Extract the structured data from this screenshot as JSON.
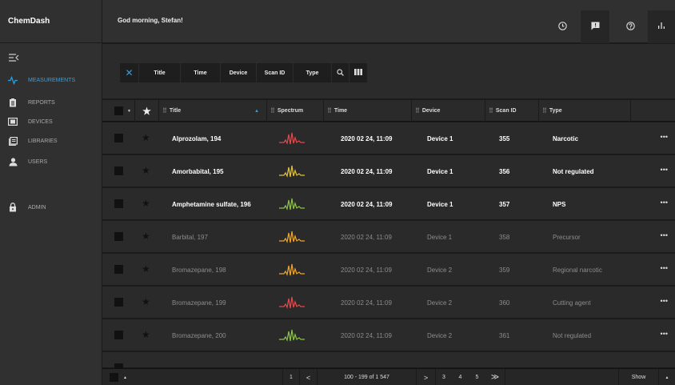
{
  "app": {
    "title": "ChemDash"
  },
  "header": {
    "greeting": "God morning, Stefan!",
    "icons": [
      "clock-icon",
      "chat-icon",
      "help-icon",
      "chart-icon"
    ]
  },
  "sidebar": {
    "items": [
      {
        "label": "MEASUREMENTS",
        "icon": "measurements-icon",
        "active": true
      },
      {
        "label": "REPORTS",
        "icon": "reports-icon"
      },
      {
        "label": "DEVICES",
        "icon": "devices-icon"
      },
      {
        "label": "LIBRARIES",
        "icon": "libraries-icon"
      },
      {
        "label": "USERS",
        "icon": "users-icon"
      },
      {
        "label": "ADMIN",
        "icon": "lock-icon"
      }
    ]
  },
  "filters": {
    "chips": [
      "Title",
      "Time",
      "Device",
      "Scan ID",
      "Type"
    ]
  },
  "table": {
    "columns": [
      "Title",
      "Spectrum",
      "Time",
      "Device",
      "Scan ID",
      "Type"
    ],
    "rows": [
      {
        "title": "Alprozolam, 194",
        "time": "2020 02 24, 11:09",
        "device": "Device 1",
        "scan_id": "355",
        "type": "Narcotic",
        "spectrum_color": "#e8474b",
        "bold": true
      },
      {
        "title": "Amorbabital, 195",
        "time": "2020 02 24, 11:09",
        "device": "Device 1",
        "scan_id": "356",
        "type": "Not regulated",
        "spectrum_color": "#e3c13b",
        "bold": true
      },
      {
        "title": "Amphetamine sulfate, 196",
        "time": "2020 02 24, 11:09",
        "device": "Device 1",
        "scan_id": "357",
        "type": "NPS",
        "spectrum_color": "#8bc34a",
        "bold": true
      },
      {
        "title": "Barbital, 197",
        "time": "2020 02 24, 11:09",
        "device": "Device 1",
        "scan_id": "358",
        "type": "Precursor",
        "spectrum_color": "#f0a52c",
        "bold": false
      },
      {
        "title": "Bromazepane, 198",
        "time": "2020 02 24, 11:09",
        "device": "Device 2",
        "scan_id": "359",
        "type": "Regional narcotic",
        "spectrum_color": "#f0a52c",
        "bold": false
      },
      {
        "title": "Bromazepane, 199",
        "time": "2020 02 24, 11:09",
        "device": "Device 2",
        "scan_id": "360",
        "type": "Cutting agent",
        "spectrum_color": "#e8474b",
        "bold": false
      },
      {
        "title": "Bromazepane, 200",
        "time": "2020 02 24, 11:09",
        "device": "Device 2",
        "scan_id": "361",
        "type": "Not regulated",
        "spectrum_color": "#8bc34a",
        "bold": false
      }
    ]
  },
  "footer": {
    "page_first": "1",
    "prev": "<",
    "range": "100 - 199 of 1 547",
    "next": ">",
    "pages": [
      "3",
      "4",
      "5"
    ],
    "last": "≫",
    "show_label": "Show"
  }
}
